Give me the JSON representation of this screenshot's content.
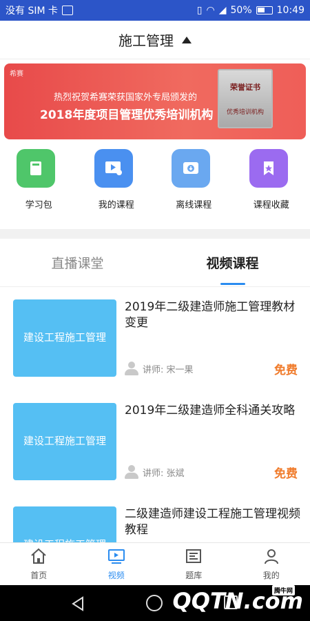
{
  "status_bar": {
    "carrier": "没有 SIM 卡",
    "battery": "50%",
    "time": "10:49"
  },
  "header": {
    "title": "施工管理"
  },
  "banner": {
    "brand": "希赛",
    "line1": "热烈祝贺希赛荣获国家外专局颁发的",
    "line2": "2018年度项目管理优秀培训机构",
    "cert_title": "荣誉证书",
    "cert_text": "优秀培训机构"
  },
  "quick_links": [
    {
      "label": "学习包",
      "color": "#4fc66a",
      "icon": "book-icon"
    },
    {
      "label": "我的课程",
      "color": "#4a90f0",
      "icon": "play-person-icon"
    },
    {
      "label": "离线课程",
      "color": "#6aa8f0",
      "icon": "download-icon"
    },
    {
      "label": "课程收藏",
      "color": "#9b6bf0",
      "icon": "bookmark-star-icon"
    }
  ],
  "tabs": [
    {
      "label": "直播课堂"
    },
    {
      "label": "视频课程"
    }
  ],
  "courses": [
    {
      "thumb": "建设工程施工管理",
      "title": "2019年二级建造师施工管理教材变更",
      "lecturer": "讲师: 宋一果",
      "price": "免费"
    },
    {
      "thumb": "建设工程施工管理",
      "title": "2019年二级建造师全科通关攻略",
      "lecturer": "讲师: 张斌",
      "price": "免费"
    },
    {
      "thumb": "建设工程施工管理",
      "title": "二级建造师建设工程施工管理视频教程",
      "lecturer": "",
      "price": ""
    }
  ],
  "bottom_nav": [
    {
      "label": "首页"
    },
    {
      "label": "视频"
    },
    {
      "label": "题库"
    },
    {
      "label": "我的"
    }
  ],
  "watermark": {
    "text": "QQTN.com",
    "tag": "腾牛网"
  }
}
